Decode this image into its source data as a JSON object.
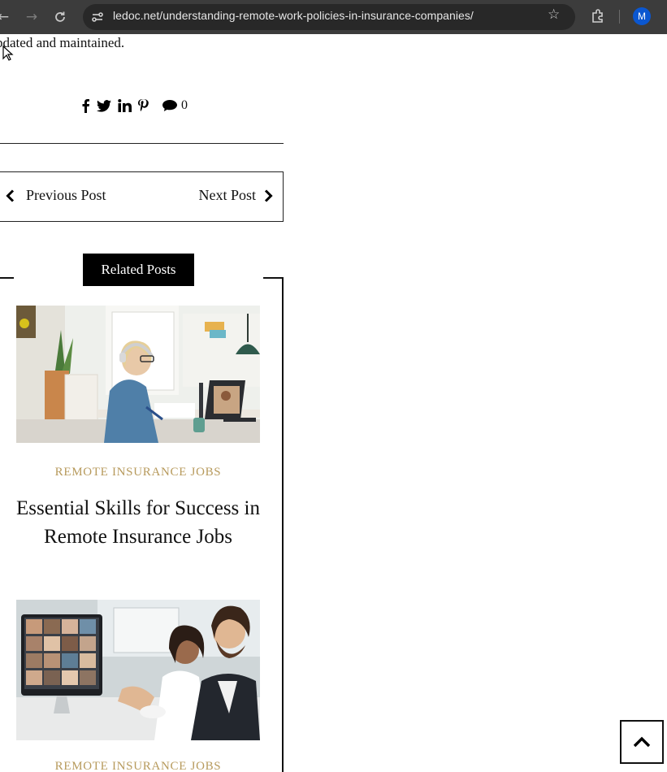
{
  "browser": {
    "url": "ledoc.net/understanding-remote-work-policies-in-insurance-companies/",
    "profile_initial": "M",
    "accent_color": "#0b57d0"
  },
  "article": {
    "trailing_text": "pdated and maintained."
  },
  "share": {
    "icons": [
      "facebook-icon",
      "twitter-icon",
      "linkedin-icon",
      "pinterest-icon",
      "comment-icon"
    ],
    "comment_count": "0"
  },
  "post_nav": {
    "previous_label": "Previous Post",
    "next_label": "Next Post"
  },
  "related": {
    "heading": "Related Posts",
    "category_color": "#b79a5c",
    "posts": [
      {
        "category": "REMOTE INSURANCE JOBS",
        "title": "Essential Skills for Success in Remote Insurance Jobs"
      },
      {
        "category": "REMOTE INSURANCE JOBS"
      }
    ]
  }
}
